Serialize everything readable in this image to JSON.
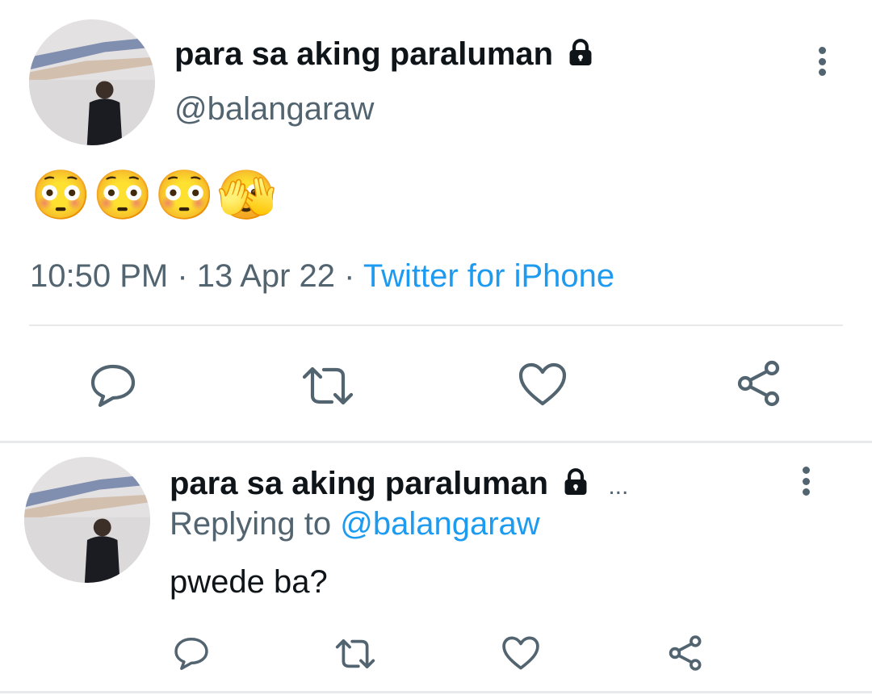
{
  "main_tweet": {
    "display_name": "para sa aking paraluman",
    "handle": "@balangaraw",
    "body_emojis": "😳😳😳🫣",
    "time": "10:50 PM",
    "separator": "·",
    "date": "13 Apr 22",
    "source": "Twitter for iPhone"
  },
  "reply_tweet": {
    "display_name": "para sa aking paraluman",
    "ellipsis": "...",
    "replying_prefix": "Replying to",
    "replying_handle": "@balangaraw",
    "text": "pwede ba?"
  },
  "icons": {
    "reply": "reply-icon",
    "retweet": "retweet-icon",
    "like": "heart-icon",
    "share": "share-icon",
    "more": "more-vertical-icon",
    "lock": "lock-icon"
  },
  "colors": {
    "text": "#0f1419",
    "secondary": "#536471",
    "link": "#1d9bf0",
    "divider": "#e7e9eb"
  }
}
